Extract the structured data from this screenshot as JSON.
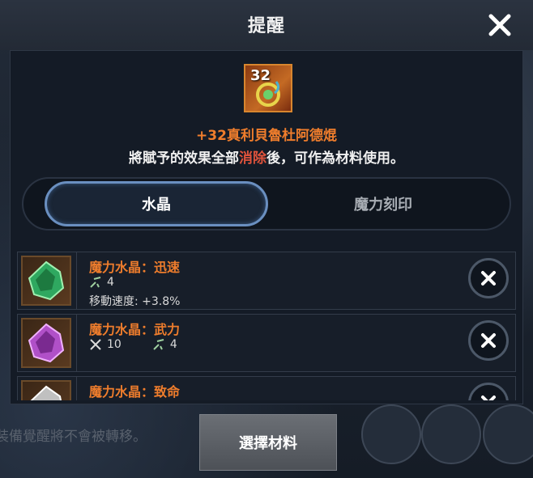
{
  "dialog": {
    "title": "提醒",
    "item": {
      "level": "32",
      "name": "+32真利貝魯杜阿德焜",
      "notice_prefix": "將賦予的效果全部",
      "notice_highlight": "消除",
      "notice_suffix": "後，可作為材料使用。"
    },
    "tabs": [
      {
        "label": "水晶",
        "active": true
      },
      {
        "label": "魔力刻印",
        "active": false
      }
    ],
    "materials": [
      {
        "name": "魔力水晶：迅速",
        "stats": [
          "4"
        ],
        "extra": "移動速度: +3.8%",
        "gem_color": "#2fa860"
      },
      {
        "name": "魔力水晶：武力",
        "stats": [
          "10",
          "4"
        ],
        "extra": "",
        "gem_color": "#b050c8"
      },
      {
        "name": "魔力水晶：致命",
        "stats": [],
        "extra": "",
        "gem_color": "#c0c0c0"
      }
    ],
    "select_button": "選擇材料"
  },
  "background": {
    "partial_text": "裝備覺醒將不會被轉移。"
  },
  "colors": {
    "accent_orange": "#ef7d2c",
    "highlight_red": "#e0533c",
    "tab_border": "#6a8fc0"
  },
  "icons": [
    "close-icon",
    "remove-icon",
    "speed-icon",
    "sword-icon",
    "crystal-icon"
  ]
}
